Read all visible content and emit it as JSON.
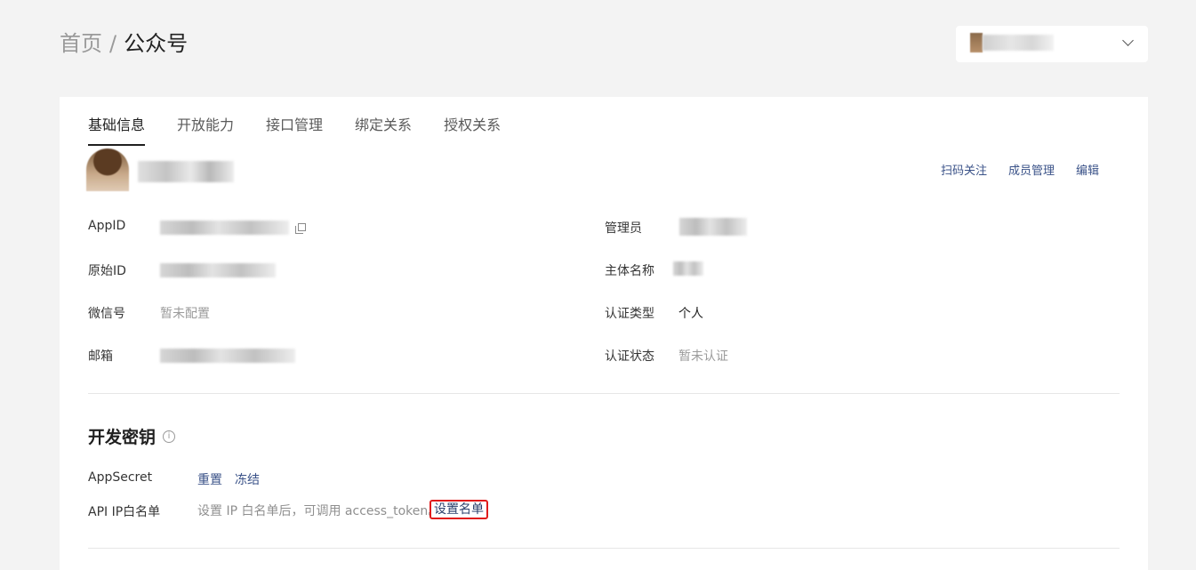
{
  "breadcrumb": {
    "home": "首页",
    "separator": "/",
    "current": "公众号"
  },
  "account_switcher": {
    "name": "",
    "icon": "chevron-down-icon"
  },
  "tabs": [
    {
      "label": "基础信息",
      "active": true
    },
    {
      "label": "开放能力",
      "active": false
    },
    {
      "label": "接口管理",
      "active": false
    },
    {
      "label": "绑定关系",
      "active": false
    },
    {
      "label": "授权关系",
      "active": false
    }
  ],
  "profile": {
    "name": ""
  },
  "top_actions": {
    "scan_follow": "扫码关注",
    "member_manage": "成员管理",
    "edit": "编辑"
  },
  "info_left": [
    {
      "label": "AppID",
      "value": ""
    },
    {
      "label": "原始ID",
      "value": ""
    },
    {
      "label": "微信号",
      "value": "暂未配置"
    },
    {
      "label": "邮箱",
      "value": ""
    }
  ],
  "info_right": [
    {
      "label": "管理员",
      "value": ""
    },
    {
      "label": "主体名称",
      "value": ""
    },
    {
      "label": "认证类型",
      "value": "个人"
    },
    {
      "label": "认证状态",
      "value": "暂未认证"
    }
  ],
  "dev_keys": {
    "title": "开发密钥",
    "info_icon": "i",
    "appsecret_label": "AppSecret",
    "reset": "重置",
    "freeze": "冻结",
    "whitelist_label": "API IP白名单",
    "whitelist_desc": "设置 IP 白名单后，可调用 access_token。",
    "whitelist_button": "设置名单"
  },
  "colors": {
    "link": "#3a5288",
    "highlight_border": "#e01b1b",
    "background": "#f3f3f3"
  }
}
